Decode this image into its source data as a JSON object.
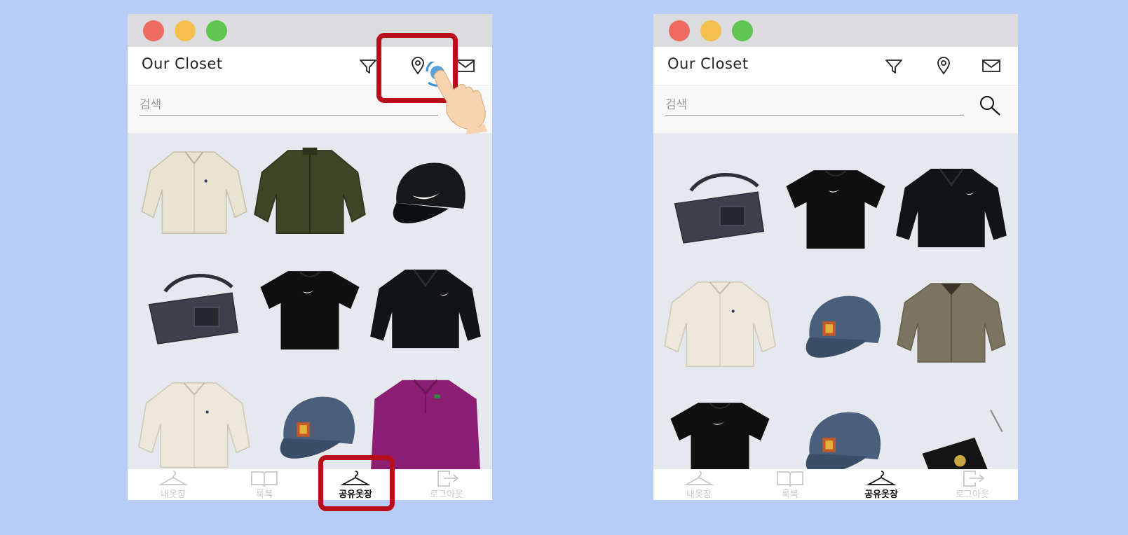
{
  "app": {
    "title": "Our Closet"
  },
  "header": {
    "icons": [
      "filter-icon",
      "location-pin-icon",
      "mail-icon"
    ]
  },
  "search": {
    "placeholder": "검색"
  },
  "nav": {
    "items": [
      {
        "label": "내옷장",
        "icon": "hanger-icon"
      },
      {
        "label": "룩북",
        "icon": "book-icon"
      },
      {
        "label": "공유옷장",
        "icon": "hanger-icon"
      },
      {
        "label": "로그아웃",
        "icon": "logout-icon"
      }
    ],
    "active_index": 2
  },
  "screens": {
    "left": {
      "items": [
        "check-shirt",
        "olive-bomber-jacket",
        "black-cap",
        "denim-shoulder-bag",
        "black-tshirt",
        "black-track-jacket",
        "cream-shirt",
        "denim-cap",
        "magenta-polo"
      ]
    },
    "right": {
      "items": [
        "denim-shoulder-bag",
        "black-tshirt",
        "black-track-jacket",
        "cream-shirt",
        "denim-cap",
        "khaki-jacket",
        "black-tshirt",
        "denim-cap",
        "black-wallet"
      ]
    }
  },
  "highlights": [
    "location-pin-icon",
    "shared-closet-tab"
  ],
  "colors": {
    "background": "#b7ccf7",
    "highlight": "#b8101a",
    "titlebar": "#dcdcdf",
    "grid": "#e5e9ed"
  }
}
